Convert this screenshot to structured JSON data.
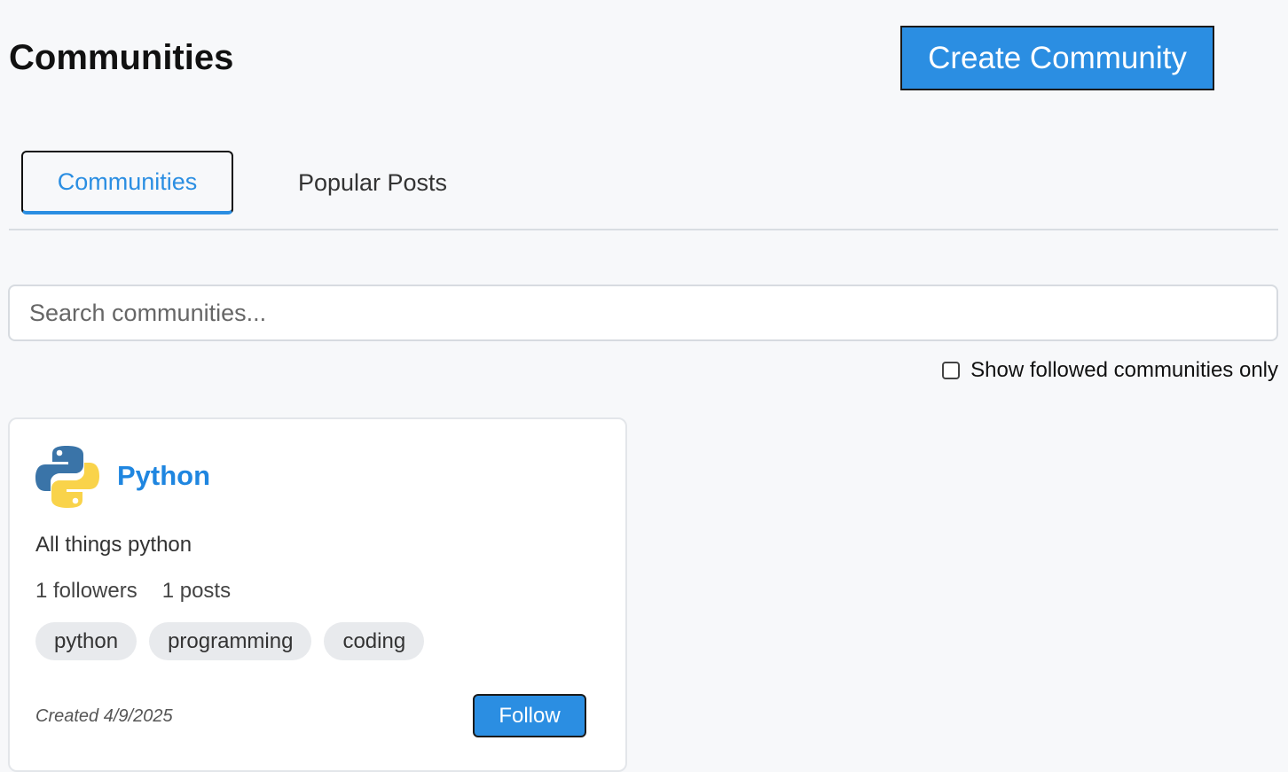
{
  "header": {
    "title": "Communities",
    "create_label": "Create Community"
  },
  "tabs": [
    {
      "label": "Communities",
      "active": true
    },
    {
      "label": "Popular Posts",
      "active": false
    }
  ],
  "search": {
    "placeholder": "Search communities...",
    "value": ""
  },
  "filter": {
    "label": "Show followed communities only",
    "checked": false
  },
  "communities": [
    {
      "name": "Python",
      "icon": "python-logo-icon",
      "description": "All things python",
      "followers": "1 followers",
      "posts": "1 posts",
      "tags": [
        "python",
        "programming",
        "coding"
      ],
      "created": "Created 4/9/2025",
      "follow_label": "Follow"
    }
  ],
  "colors": {
    "accent": "#2b8ee2",
    "title_link": "#1f86e0",
    "background": "#f7f8fa",
    "tag_bg": "#e8eaed"
  }
}
